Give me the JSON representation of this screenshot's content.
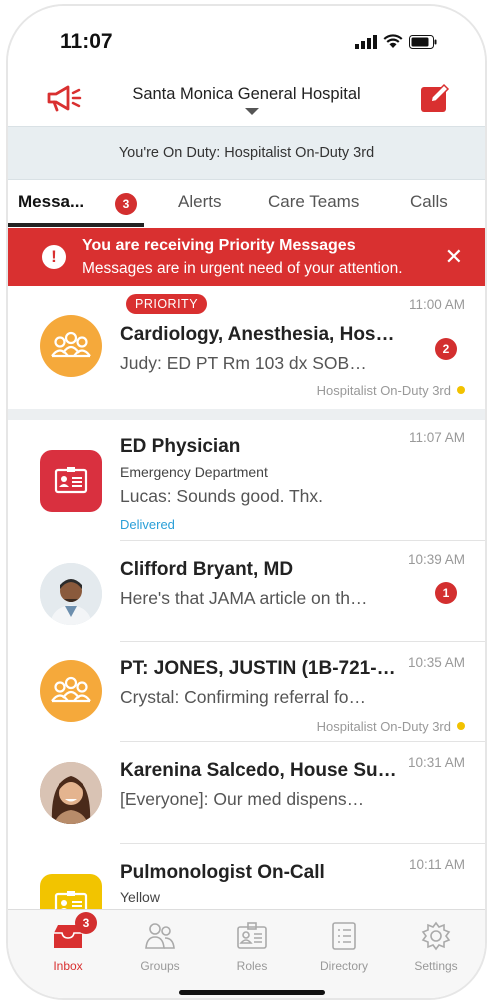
{
  "status_bar": {
    "time": "11:07"
  },
  "header": {
    "hospital": "Santa Monica General Hospital"
  },
  "duty_bar": {
    "text": "You're On Duty: Hospitalist On-Duty 3rd"
  },
  "tabs": [
    {
      "label": "Messa...",
      "badge": "3"
    },
    {
      "label": "Alerts"
    },
    {
      "label": "Care Teams"
    },
    {
      "label": "Calls"
    }
  ],
  "banner": {
    "title": "You are receiving Priority Messages",
    "subtitle": "Messages are in urgent need of your attention.",
    "close": "✕",
    "icon": "!"
  },
  "priority_row": {
    "pill": "PRIORITY",
    "title": "Cardiology, Anesthesia, Hos…",
    "preview": "Judy: ED PT Rm 103 dx SOB…",
    "time": "11:00 AM",
    "count": "2",
    "role": "Hospitalist On-Duty 3rd"
  },
  "rows": [
    {
      "title": "ED Physician",
      "subtitle": "Emergency Department",
      "preview": "Lucas: Sounds good. Thx.",
      "status": "Delivered",
      "time": "11:07 AM"
    },
    {
      "title": "Clifford Bryant, MD",
      "preview": "Here's that JAMA article on th…",
      "time": "10:39 AM",
      "count": "1"
    },
    {
      "title": "PT: JONES, JUSTIN (1B-721-…",
      "preview": "Crystal: Confirming referral fo…",
      "time": "10:35 AM",
      "role": "Hospitalist On-Duty 3rd"
    },
    {
      "title": "Karenina Salcedo, House Su…",
      "preview": "[Everyone]: Our med dispens…",
      "time": "10:31 AM"
    },
    {
      "title": "Pulmonologist On-Call",
      "subtitle": "Yellow",
      "time": "10:11 AM"
    }
  ],
  "tab_bar": [
    {
      "label": "Inbox",
      "badge": "3",
      "icon": "inbox-icon"
    },
    {
      "label": "Groups",
      "icon": "groups-icon"
    },
    {
      "label": "Roles",
      "icon": "roles-icon"
    },
    {
      "label": "Directory",
      "icon": "directory-icon"
    },
    {
      "label": "Settings",
      "icon": "settings-icon"
    }
  ],
  "colors": {
    "accent": "#d93030",
    "group_avatar": "#f5a93b",
    "role_dot": "#f2c200"
  }
}
